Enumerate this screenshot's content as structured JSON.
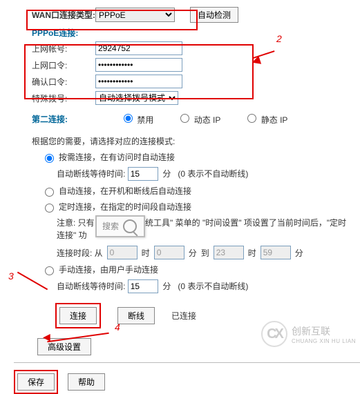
{
  "wan": {
    "label": "WAN口连接类型:",
    "selected": "PPPoE",
    "detect_btn": "自动检测"
  },
  "pppoe": {
    "header": "PPPoE连接:",
    "account_label": "上网帐号:",
    "account_value": "2924752",
    "password_label": "上网口令:",
    "confirm_label": "确认口令:",
    "special_label": "特殊拨号:",
    "special_selected": "自动选择拨号模式"
  },
  "annotations": {
    "n2": "2",
    "n3": "3",
    "n4": "4"
  },
  "second_conn": {
    "label": "第二连接:",
    "opts": {
      "disable": "禁用",
      "dyn": "动态 IP",
      "static": "静态 IP"
    }
  },
  "mode_desc": "根据您的需要，请选择对应的连接模式:",
  "modes": {
    "on_demand": "按需连接，在有访问时自动连接",
    "auto_wait_label": "自动断线等待时间:",
    "auto_wait_value": "15",
    "minutes": "分",
    "zero_note": "(0 表示不自动断线)",
    "auto": "自动连接，在开机和断线后自动连接",
    "timed": "定时连接，在指定的时间段自动连接",
    "notice_a": "注意: 只有",
    "notice_b": "统工具\" 菜单的 \"时间设置\" 项设置了当前时间后，\"定时连接\" 功",
    "search_placeholder": "搜索",
    "period_label": "连接时段: 从",
    "h": "时",
    "m": "分",
    "to": "到",
    "t_from_h": "0",
    "t_from_m": "0",
    "t_to_h": "23",
    "t_to_m": "59",
    "manual": "手动连接，由用户手动连接",
    "auto_wait2_value": "15"
  },
  "buttons": {
    "connect": "连接",
    "disconnect": "断线",
    "status": "已连接",
    "advanced": "高级设置",
    "save": "保存",
    "help": "帮助"
  },
  "watermark": {
    "brand": "创新互联",
    "en": "CHUANG XIN HU LIAN"
  }
}
